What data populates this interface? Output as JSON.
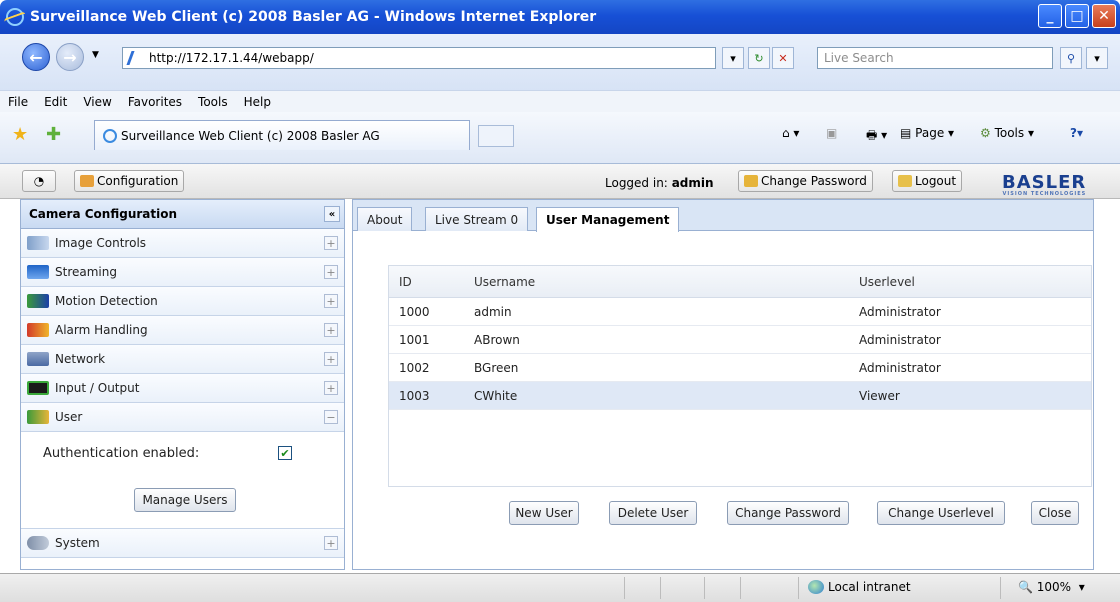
{
  "window": {
    "title": "Surveillance Web Client (c) 2008 Basler AG - Windows Internet Explorer"
  },
  "address": {
    "url": "http://172.17.1.44/webapp/",
    "search_placeholder": "Live Search"
  },
  "menu": [
    "File",
    "Edit",
    "View",
    "Favorites",
    "Tools",
    "Help"
  ],
  "browser_tab": {
    "title": "Surveillance Web Client (c) 2008 Basler AG"
  },
  "commands": {
    "page": "Page",
    "tools": "Tools"
  },
  "app_toolbar": {
    "configuration": "Configuration",
    "logged_in_label": "Logged in:",
    "logged_in_user": "admin",
    "change_password": "Change Password",
    "logout": "Logout",
    "logo": "BASLER",
    "logo_sub": "VISION TECHNOLOGIES"
  },
  "sidebar": {
    "title": "Camera Configuration",
    "items": [
      "Image Controls",
      "Streaming",
      "Motion Detection",
      "Alarm Handling",
      "Network",
      "Input / Output",
      "User"
    ],
    "system": "System",
    "auth_label": "Authentication enabled:",
    "auth_checked": true,
    "manage_users": "Manage Users"
  },
  "tabs": [
    "About",
    "Live Stream 0",
    "User Management"
  ],
  "active_tab": "User Management",
  "users_table": {
    "columns": [
      "ID",
      "Username",
      "Userlevel"
    ],
    "rows": [
      {
        "id": "1000",
        "username": "admin",
        "level": "Administrator"
      },
      {
        "id": "1001",
        "username": "ABrown",
        "level": "Administrator"
      },
      {
        "id": "1002",
        "username": "BGreen",
        "level": "Administrator"
      },
      {
        "id": "1003",
        "username": "CWhite",
        "level": "Viewer"
      }
    ],
    "selected_row": 3
  },
  "actions": {
    "new_user": "New User",
    "delete_user": "Delete User",
    "change_password": "Change Password",
    "change_userlevel": "Change Userlevel",
    "close": "Close"
  },
  "statusbar": {
    "zone": "Local intranet",
    "zoom": "100%"
  }
}
